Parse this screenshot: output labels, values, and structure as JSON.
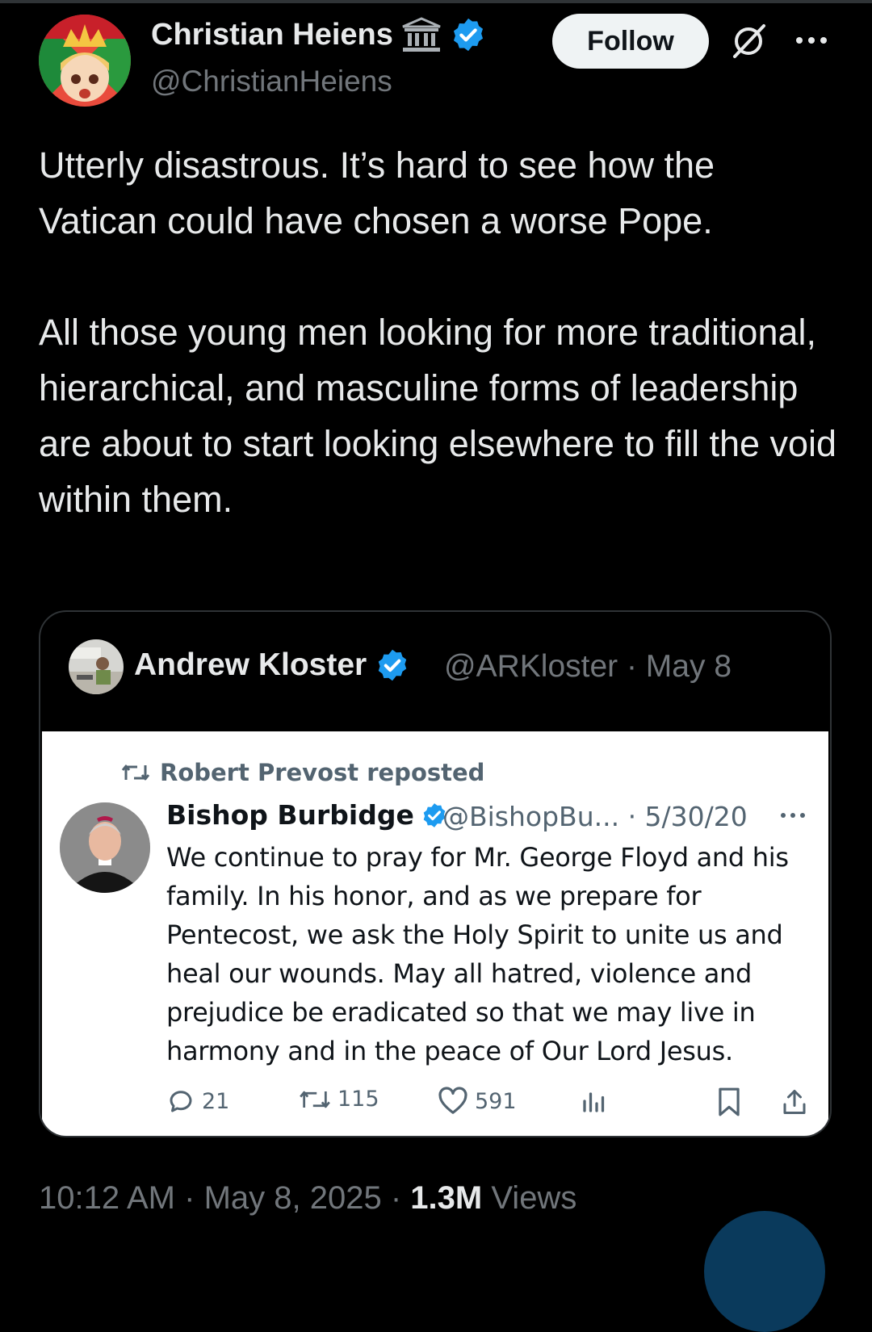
{
  "header": {
    "display_name": "Christian Heiens",
    "handle": "@ChristianHeiens",
    "follow_label": "Follow"
  },
  "tweet": {
    "paragraphs": [
      "Utterly disastrous. It’s hard to see how the Vatican could have chosen a worse Pope.",
      "All those young men looking for more traditional, hierarchical, and masculine forms of leadership are about to start looking elsewhere to fill the void within them."
    ]
  },
  "quote": {
    "name": "Andrew Kloster",
    "handle": "@ARKloster",
    "date": "May 8",
    "meta": "@ARKloster · May 8",
    "embed": {
      "repost_label": "Robert Prevost reposted",
      "name": "Bishop Burbidge",
      "meta": "@BishopBu... · 5/30/20",
      "text": "We continue to pray for Mr. George Floyd and his family. In his honor, and as we prepare for Pentecost, we ask the Holy Spirit to unite us and heal our wounds. May all hatred, violence and prejudice be eradicated so that we may live in harmony and in the peace of Our Lord Jesus.",
      "replies": "21",
      "reposts": "115",
      "likes": "591"
    }
  },
  "footer": {
    "time": "10:12 AM",
    "date": "May 8, 2025",
    "views_count": "1.3M",
    "views_label": "Views"
  },
  "colors": {
    "background": "#000000",
    "text_primary": "#e7e9ea",
    "text_secondary": "#71767b",
    "verified_blue": "#1d9bf0",
    "border": "#2f3336"
  }
}
